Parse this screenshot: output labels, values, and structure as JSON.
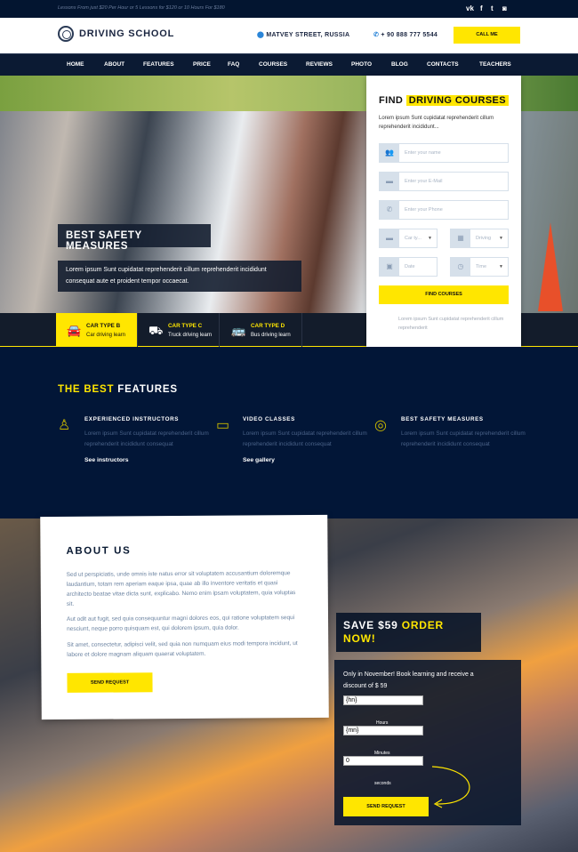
{
  "topbar": {
    "tagline": "Lessons From just $20 Per Hour or 5 Lessons for $120 or 10 Hours For $180",
    "social": [
      "vk-icon",
      "facebook-icon",
      "twitter-icon",
      "instagram-icon"
    ],
    "social_glyphs": [
      "vk",
      "f",
      "t",
      "◙"
    ]
  },
  "header": {
    "logo": "DRIVING SCHOOL",
    "address": "MATVEY STREET, RUSSIA",
    "phone": "+ 90 888 777 5544",
    "call_label": "CALL ME"
  },
  "nav": [
    "HOME",
    "ABOUT",
    "FEATURES",
    "PRICE",
    "FAQ",
    "COURSES",
    "REVIEWS",
    "PHOTO",
    "BLOG",
    "CONTACTS",
    "TEACHERS"
  ],
  "hero": {
    "title": "BEST SAFETY MEASURES",
    "text": "Lorem ipsum Sunt cupidatat reprehenderit cillum reprehenderit incididunt consequat aute et proident tempor occaecat."
  },
  "car_types": [
    {
      "name": "CAR TYPE B",
      "desc": "Car driving learn",
      "active": true
    },
    {
      "name": "CAR TYPE C",
      "desc": "Truck driving learn"
    },
    {
      "name": "CAR TYPE D",
      "desc": "Bus driving learn"
    }
  ],
  "form": {
    "title_plain": "FIND",
    "title_highlight": "DRIVING COURSES",
    "desc": "Lorem ipsum Sunt cupidatat reprehenderit cillum reprehenderit incididunt...",
    "name_ph": "Enter your name",
    "email_ph": "Enter your E-Mail",
    "phone_ph": "Enter your Phone",
    "car_type": "Car ty...",
    "driving": "Driving",
    "date_ph": "Date",
    "time": "Time",
    "submit": "FIND COURSES",
    "note": "Lorem ipsum Sunt cupidatat reprehenderit cillum reprehenderit"
  },
  "features": {
    "title_highlight": "THE BEST",
    "title_plain": "FEATURES",
    "items": [
      {
        "title": "EXPERIENCED INSTRUCTORS",
        "text": "Lorem ipsum Sunt cupidatat reprehenderit cillum reprehenderit incididunt consequat",
        "link": "See instructors"
      },
      {
        "title": "VIDEO CLASSES",
        "text": "Lorem ipsum Sunt cupidatat reprehenderit cillum reprehenderit incididunt consequat",
        "link": "See gallery"
      },
      {
        "title": "BEST SAFETY MEASURES",
        "text": "Lorem ipsum Sunt cupidatat reprehenderit cillum reprehenderit incididunt consequat"
      }
    ]
  },
  "about": {
    "title": "ABOUT US",
    "p1": "Sed ut perspiciatis, unde omnis iste natus error sit voluptatem accusantium doloremque laudantium, totam rem aperiam eaque ipsa, quae ab illo inventore veritatis et quasi architecto beatae vitae dicta sunt, explicabo. Nemo enim ipsam voluptatem, quia voluptas sit.",
    "p2": "Aut odit aut fugit, sed quia consequuntur magni dolores eos, qui ratione voluptatem sequi nesciunt, neque porro quisquam est, qui dolorem ipsum, quia dolor.",
    "p3": "Sit amet, consectetur, adipisci velit, sed quia non numquam eius modi tempora incidunt, ut labore et dolore magnam aliquam quaerat voluptatem.",
    "button": "SEND REQUEST"
  },
  "offer": {
    "title_plain": "SAVE $59",
    "title_highlight": "ORDER NOW!",
    "text": "Only in November! Book learning and receive a discount of $ 59",
    "hours_value": "{hn}",
    "hours_label": "Hours",
    "minutes_value": "{mn}",
    "minutes_label": "Minutes",
    "seconds_value": "0",
    "seconds_label": "seconds",
    "button": "SEND REQUEST"
  },
  "colors": {
    "accent": "#ffe600",
    "navy": "#021637"
  }
}
